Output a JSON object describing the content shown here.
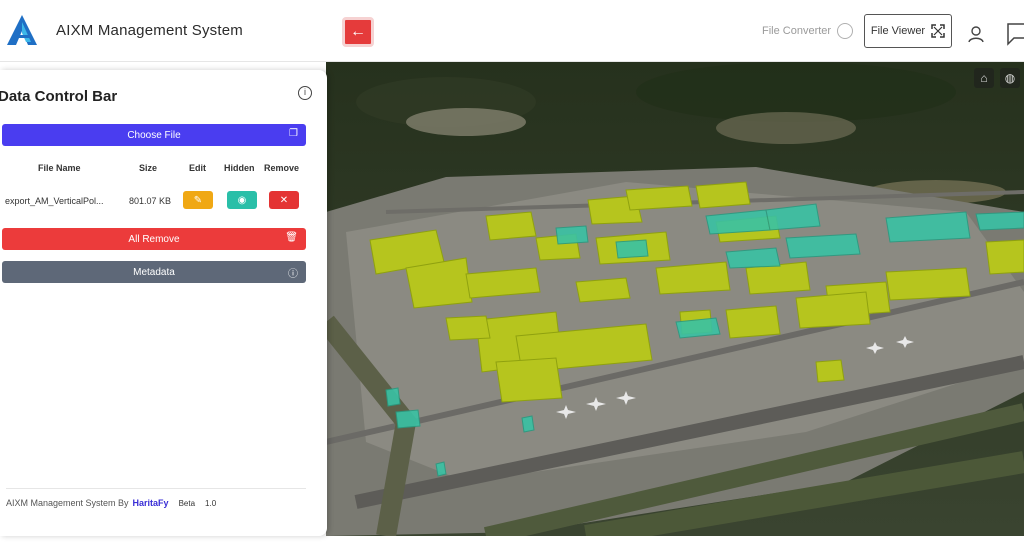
{
  "app": {
    "title": "AIXM Management System"
  },
  "header": {
    "back_label": "←",
    "file_converter_label": "File Converter",
    "file_viewer_label": "File Viewer"
  },
  "panel": {
    "title": "Data Control Bar",
    "choose_file_label": "Choose File",
    "table": {
      "headers": [
        "File Name",
        "Size",
        "Edit",
        "Hidden",
        "Remove"
      ],
      "rows": [
        {
          "file_name": "export_AM_VerticalPol...",
          "size": "801.07 KB"
        }
      ]
    },
    "all_remove_label": "All Remove",
    "metadata_label": "Metadata",
    "footer": {
      "text": "AIXM Management System By",
      "brand": "HaritaFy",
      "beta_label": "Beta",
      "version": "1.0"
    }
  },
  "colors": {
    "primary": "#4a3df0",
    "danger": "#ec3b3b",
    "metadata": "#5e6878",
    "edit": "#f0a814",
    "hidden": "#29bfa8",
    "remove": "#e43434"
  },
  "icons": {
    "back": "arrow-left-icon",
    "file_converter": "refresh-icon",
    "file_viewer": "expand-icon",
    "user": "user-icon",
    "info": "info-icon",
    "upload": "copy-icon",
    "trash": "trash-icon",
    "edit": "pencil-icon",
    "eye": "eye-icon",
    "close": "close-icon",
    "home": "home-icon",
    "globe": "globe-icon"
  }
}
